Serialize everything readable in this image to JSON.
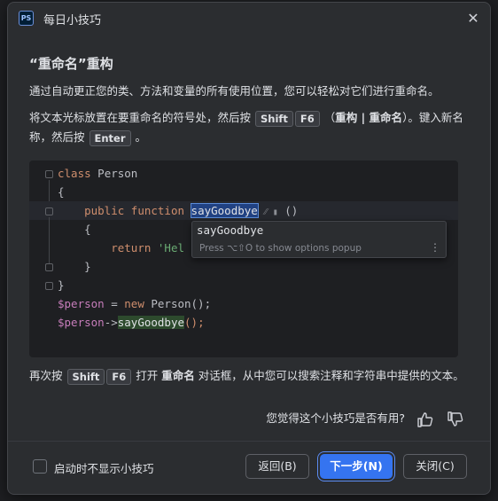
{
  "window": {
    "app_icon_text": "PS",
    "title": "每日小技巧",
    "close_glyph": "✕"
  },
  "tip": {
    "heading": "“重命名”重构",
    "para1": "通过自动更正您的类、方法和变量的所有使用位置，您可以轻松对它们进行重命名。",
    "para2": {
      "pre": "将文本光标放置在要重命名的符号处，然后按",
      "key1": "Shift",
      "key2": "F6",
      "mid": "（",
      "action": "重构 | 重命名",
      "post": "）。键入新名称，然后按",
      "key3": "Enter",
      "end": "。"
    },
    "para3": {
      "pre": "再次按",
      "key1": "Shift",
      "key2": "F6",
      "mid": "打开",
      "action": "重命名",
      "post": "对话框，从中您可以搜索注释和字符串中提供的文本。"
    }
  },
  "code": {
    "l1_kw": "class",
    "l1_name": " Person",
    "l2": "{",
    "l3_kw1": "public",
    "l3_kw2": "function",
    "l3_name": "sayGoodbye",
    "l3_icons": "⁄⁄ ▮",
    "l3_paren": "()",
    "l4": "{",
    "l5_kw": "return",
    "l5_str": "'Hel",
    "l6": "}",
    "l7": "}",
    "l8_var": "$person",
    "l8_eq": " = ",
    "l8_kw": "new",
    "l8_rest": " Person();",
    "l9_var": "$person",
    "l9_arrow": "->",
    "l9_call": "sayGoodbye",
    "l9_end": "();"
  },
  "popup": {
    "item": "sayGoodbye",
    "hint": "Press ⌥⇧O to show options popup",
    "menu_glyph": "⋮"
  },
  "feedback": {
    "question": "您觉得这个小技巧是否有用?"
  },
  "footer": {
    "checkbox_label": "启动时不显示小技巧",
    "back_label": "返回(B)",
    "next_label": "下一步(N)",
    "close_label": "关闭(C)"
  },
  "colors": {
    "accent": "#3574f0",
    "dialog_bg": "#2b2d30",
    "code_bg": "#1e1f22"
  }
}
